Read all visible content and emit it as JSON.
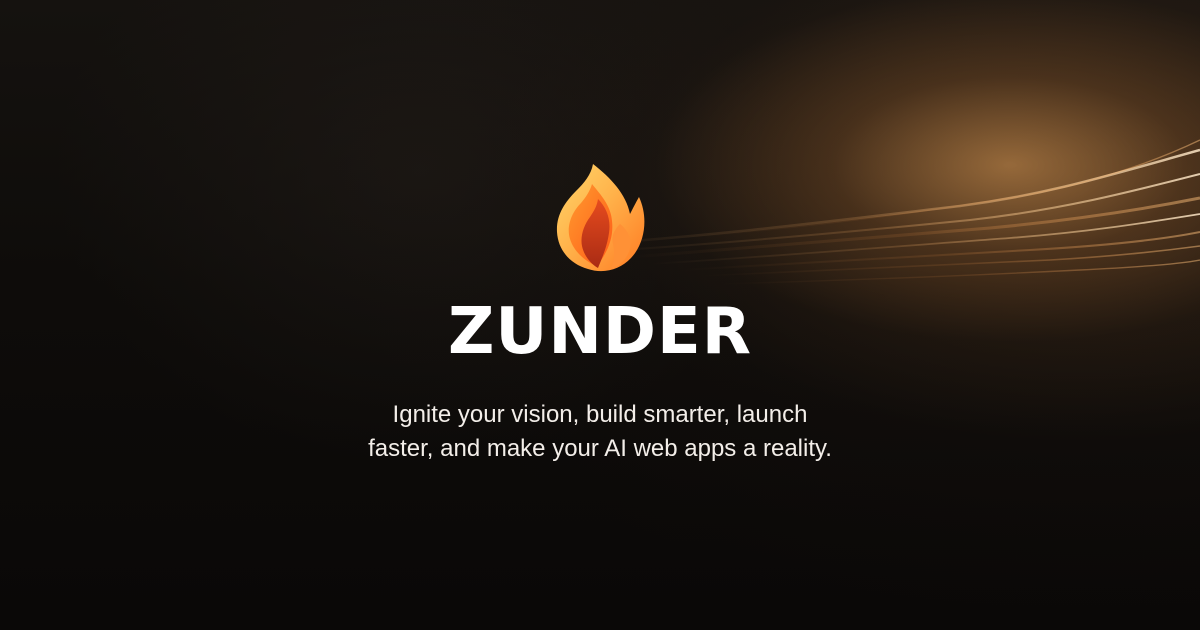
{
  "brand": {
    "name": "ZUNDER",
    "logo_icon": "flame-icon",
    "tagline_line1": "Ignite your vision, build smarter, launch",
    "tagline_line2": "faster, and make your AI web apps a reality."
  },
  "colors": {
    "background": "#0b0908",
    "text": "#ffffff",
    "flame_light": "#ffcf57",
    "flame_orange": "#ff6a1a",
    "flame_red": "#c83718",
    "glow": "#d6904f"
  }
}
